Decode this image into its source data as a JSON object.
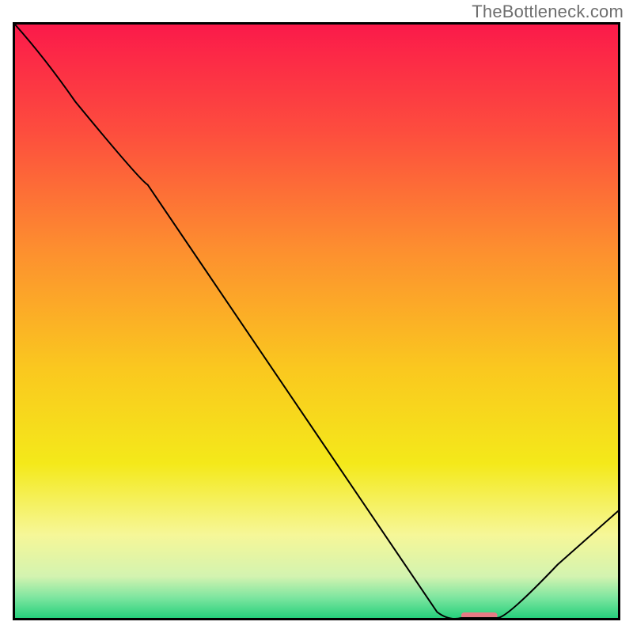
{
  "watermark": "TheBottleneck.com",
  "chart_data": {
    "type": "line",
    "title": "",
    "xlabel": "",
    "ylabel": "",
    "xlim": [
      0,
      100
    ],
    "ylim": [
      0,
      100
    ],
    "grid": false,
    "series": [
      {
        "name": "curve",
        "x": [
          0,
          10,
          22,
          70,
          74,
          80,
          100
        ],
        "y": [
          100,
          87,
          73,
          1,
          0,
          0,
          18
        ],
        "stroke": "#000000",
        "stroke_width": 2
      }
    ],
    "optimal_marker": {
      "x_start": 74,
      "x_end": 80,
      "color": "#e67b84",
      "thickness": 8
    },
    "background_gradient": {
      "stops": [
        {
          "offset": 0.0,
          "color": "#fb1a4a"
        },
        {
          "offset": 0.18,
          "color": "#fd4d3e"
        },
        {
          "offset": 0.38,
          "color": "#fd8f2f"
        },
        {
          "offset": 0.58,
          "color": "#fac81f"
        },
        {
          "offset": 0.74,
          "color": "#f4e91a"
        },
        {
          "offset": 0.86,
          "color": "#f6f798"
        },
        {
          "offset": 0.93,
          "color": "#d3f3b0"
        },
        {
          "offset": 0.965,
          "color": "#7fe6a0"
        },
        {
          "offset": 1.0,
          "color": "#26d07c"
        }
      ]
    }
  }
}
